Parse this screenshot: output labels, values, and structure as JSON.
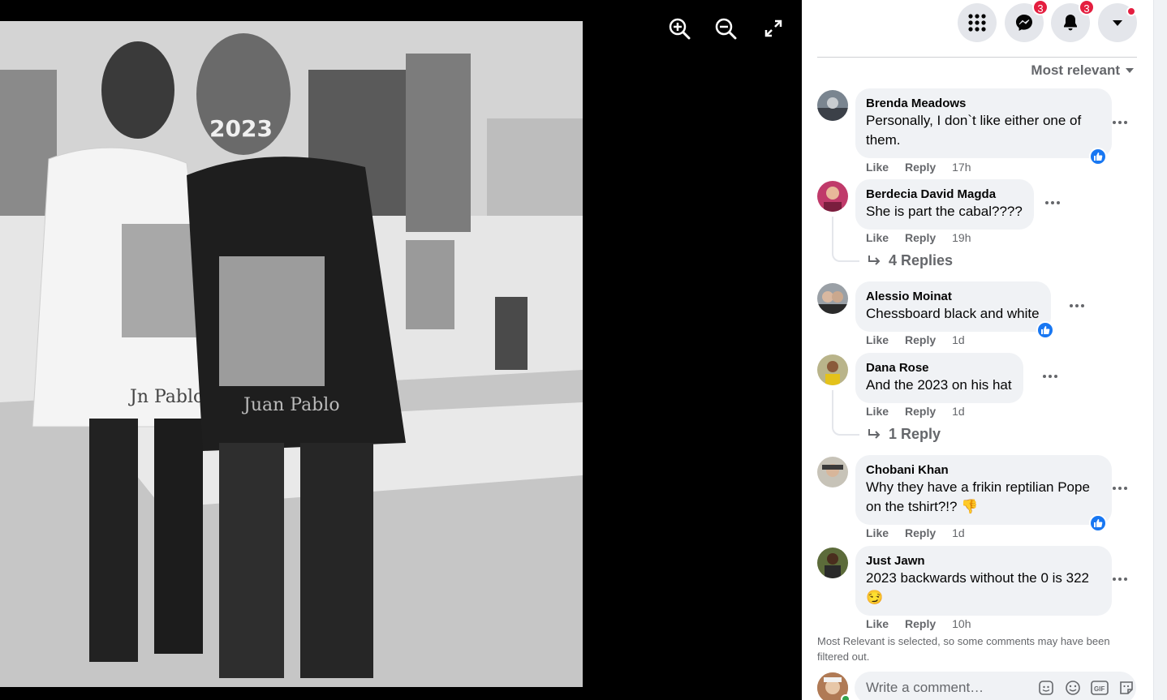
{
  "viewer": {
    "tools": [
      "zoom-in-icon",
      "zoom-out-icon",
      "fullscreen-icon"
    ],
    "photo": {
      "hat_text": "2023",
      "shirt_text_left": "Jn Pablo",
      "shirt_text_right": "Juan Pablo"
    }
  },
  "header": {
    "buttons": [
      {
        "icon": "apps-grid-icon"
      },
      {
        "icon": "messenger-icon",
        "badge": "3"
      },
      {
        "icon": "bell-icon",
        "badge": "3"
      },
      {
        "icon": "caret-down-icon"
      }
    ]
  },
  "sort": {
    "label": "Most relevant"
  },
  "comments": [
    {
      "author": "Brenda Meadows",
      "text": "Personally, I don`t like either one of them.",
      "like": "Like",
      "reply": "Reply",
      "time": "17h",
      "reaction": "like"
    },
    {
      "author": "Berdecia David Magda",
      "text": "She is part the cabal????",
      "like": "Like",
      "reply": "Reply",
      "time": "19h",
      "replies": "4 Replies"
    },
    {
      "author": "Alessio Moinat",
      "text": "Chessboard black and white",
      "like": "Like",
      "reply": "Reply",
      "time": "1d",
      "reaction": "like"
    },
    {
      "author": "Dana Rose",
      "text": "And the 2023 on his hat",
      "like": "Like",
      "reply": "Reply",
      "time": "1d",
      "replies": "1 Reply"
    },
    {
      "author": "Chobani Khan",
      "text": "Why they have a frikin reptilian Pope on the tshirt?!? 👎",
      "like": "Like",
      "reply": "Reply",
      "time": "1d",
      "reaction": "like"
    },
    {
      "author": "Just Jawn",
      "text": "2023 backwards without the 0 is 322 😏",
      "like": "Like",
      "reply": "Reply",
      "time": "10h"
    }
  ],
  "filter_note": "Most Relevant is selected, so some comments may have been filtered out.",
  "composer": {
    "placeholder": "Write a comment…",
    "icons": [
      "sticker-face-icon",
      "emoji-icon",
      "gif-icon",
      "sticker-icon"
    ]
  },
  "colors": {
    "accent": "#1877f2",
    "badge": "#e41e3f",
    "bubble": "#f0f2f5",
    "secondary_text": "#65676b"
  }
}
